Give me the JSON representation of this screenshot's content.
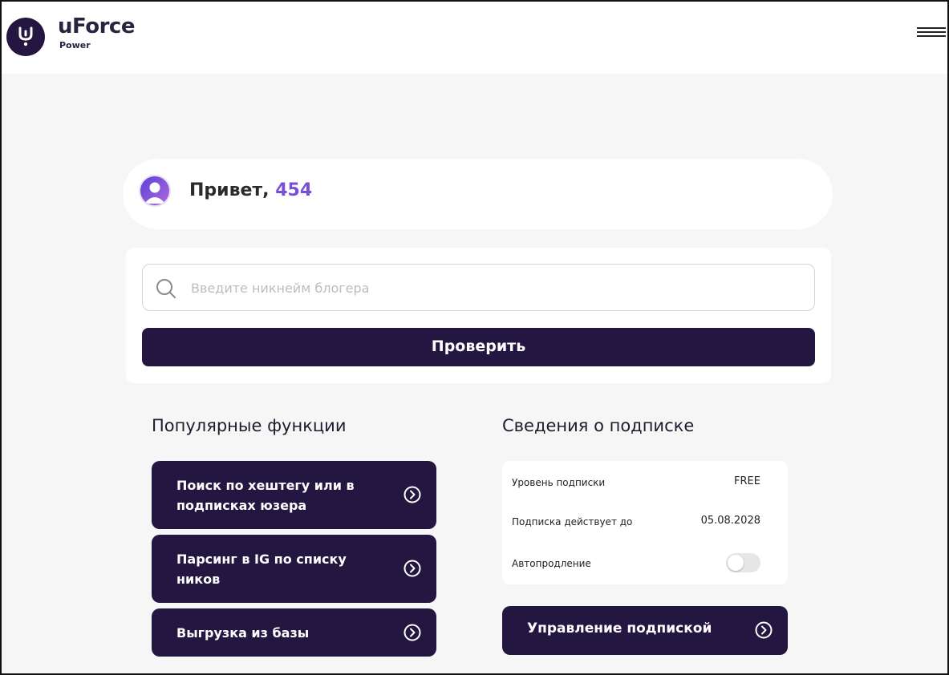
{
  "header": {
    "brand_name": "uForce",
    "brand_sub": "Power",
    "logo_icon": "uforce-logo-icon",
    "menu_icon": "hamburger-menu-icon"
  },
  "greeting": {
    "prefix": "Привет,",
    "username": "454",
    "avatar_icon": "user-avatar-icon"
  },
  "search": {
    "placeholder": "Введите никнейм блогера",
    "value": "",
    "button_label": "Проверить",
    "icon": "search-icon"
  },
  "popular": {
    "title": "Популярные функции",
    "items": [
      {
        "label": "Поиск по хештегу или в подписках юзера",
        "icon": "chevron-right-circle-icon"
      },
      {
        "label": "Парсинг в IG по списку ников",
        "icon": "chevron-right-circle-icon"
      },
      {
        "label": "Выгрузка из базы",
        "icon": "chevron-right-circle-icon"
      }
    ]
  },
  "subscription": {
    "title": "Сведения о подписке",
    "level_label": "Уровень подписки",
    "level_value": "FREE",
    "valid_label": "Подписка действует до",
    "valid_value": "05.08.2028",
    "autorenew_label": "Автопродление",
    "autorenew_on": false,
    "manage_label": "Управление подпиской"
  },
  "colors": {
    "primary": "#231741",
    "accent": "#7a4fd8",
    "background": "#f6f6f6"
  }
}
